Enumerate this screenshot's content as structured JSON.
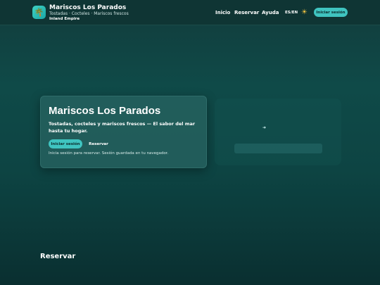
{
  "header": {
    "brand_title": "Mariscos Los Parados",
    "brand_subtitle": "Tostadas · Cocteles · Mariscos frescos",
    "brand_location": "Inland Empire",
    "nav": [
      "Inicio",
      "Reservar",
      "Ayuda"
    ],
    "lang_toggle": "ES/EN",
    "theme_icon": "sun-icon",
    "login_label": "Iniciar sesión"
  },
  "hero": {
    "title": "Mariscos Los Parados",
    "description": "Tostadas, cocteles y mariscos frescos — El sabor del mar hasta tu hogar.",
    "login_label": "Iniciar sesión",
    "reserve_label": "Reservar",
    "note": "Inicia sesión para reservar. Sesión guardada en tu navegador."
  },
  "section": {
    "title": "Reservar"
  },
  "colors": {
    "accent": "#3fc4c0",
    "background": "#0f4a48",
    "header": "#0f3534"
  }
}
